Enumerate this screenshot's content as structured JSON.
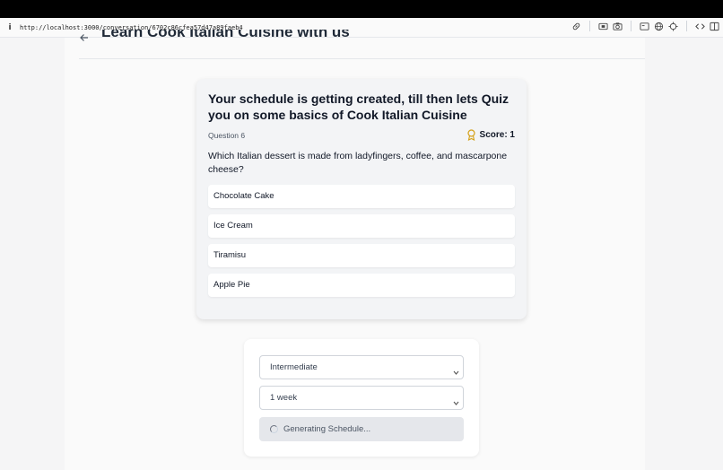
{
  "browser": {
    "url": "http://localhost:3000/conversation/6702c86cfea57d47a89faeb4",
    "info_icon": "i",
    "tools": [
      "link-icon",
      "screenshot-icon",
      "camera-icon",
      "window-icon",
      "globe-icon",
      "crosshair-icon",
      "code-icon",
      "sidebar-icon"
    ]
  },
  "header": {
    "title": "Learn Cook Italian Cuisine with us"
  },
  "quiz": {
    "heading": "Your schedule is getting created, till then lets Quiz you on some basics of Cook Italian Cuisine",
    "question_number": "Question 6",
    "score": "Score: 1",
    "question": "Which Italian dessert is made from ladyfingers, coffee, and mascarpone cheese?",
    "options": [
      "Chocolate Cake",
      "Ice Cream",
      "Tiramisu",
      "Apple Pie"
    ]
  },
  "form": {
    "level": "Intermediate",
    "duration": "1 week",
    "status": "Generating Schedule..."
  },
  "colors": {
    "accent_award": "#d4a017",
    "card_bg": "#f3f4f6"
  }
}
